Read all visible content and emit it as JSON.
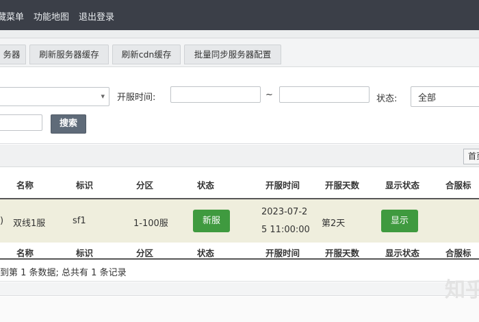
{
  "topnav": {
    "menu_label": "藏菜单",
    "map_label": "功能地图",
    "logout_label": "退出登录"
  },
  "tabs": [
    "务器",
    "刷新服务器缓存",
    "刷新cdn缓存",
    "批量同步服务器配置"
  ],
  "filters": {
    "open_time_label": "开服时间:",
    "range_separator": "~",
    "status_label": "状态:",
    "status_value": "全部",
    "search_button": "搜索"
  },
  "pagination": {
    "first_label": "首页"
  },
  "table": {
    "headers": [
      "名称",
      "标识",
      "分区",
      "状态",
      "开服时间",
      "开服天数",
      "显示状态",
      "合服标"
    ],
    "rows": [
      {
        "id_fragment": ")",
        "name": "双线1服",
        "tag": "sf1",
        "zone": "1-100服",
        "status": "新服",
        "open_time_line1": "2023-07-2",
        "open_time_line2": "5 11:00:00",
        "days": "第2天",
        "display_status": "显示"
      }
    ]
  },
  "summary_text": "到第 1 条数据; 总共有 1 条记录",
  "watermark": "知乎",
  "colors": {
    "topbar": "#3b3f48",
    "status_green": "#3f9a3f",
    "row_highlight": "#efeedd",
    "search_button": "#5f6b79"
  }
}
